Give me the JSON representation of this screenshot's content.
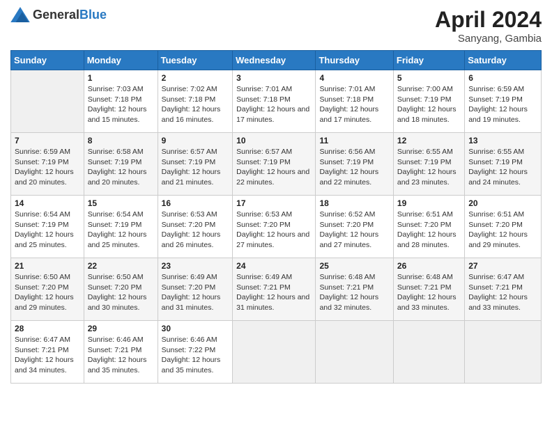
{
  "header": {
    "logo_general": "General",
    "logo_blue": "Blue",
    "month_year": "April 2024",
    "location": "Sanyang, Gambia"
  },
  "days_of_week": [
    "Sunday",
    "Monday",
    "Tuesday",
    "Wednesday",
    "Thursday",
    "Friday",
    "Saturday"
  ],
  "weeks": [
    [
      {
        "day": "",
        "sunrise": "",
        "sunset": "",
        "daylight": ""
      },
      {
        "day": "1",
        "sunrise": "Sunrise: 7:03 AM",
        "sunset": "Sunset: 7:18 PM",
        "daylight": "Daylight: 12 hours and 15 minutes."
      },
      {
        "day": "2",
        "sunrise": "Sunrise: 7:02 AM",
        "sunset": "Sunset: 7:18 PM",
        "daylight": "Daylight: 12 hours and 16 minutes."
      },
      {
        "day": "3",
        "sunrise": "Sunrise: 7:01 AM",
        "sunset": "Sunset: 7:18 PM",
        "daylight": "Daylight: 12 hours and 17 minutes."
      },
      {
        "day": "4",
        "sunrise": "Sunrise: 7:01 AM",
        "sunset": "Sunset: 7:18 PM",
        "daylight": "Daylight: 12 hours and 17 minutes."
      },
      {
        "day": "5",
        "sunrise": "Sunrise: 7:00 AM",
        "sunset": "Sunset: 7:19 PM",
        "daylight": "Daylight: 12 hours and 18 minutes."
      },
      {
        "day": "6",
        "sunrise": "Sunrise: 6:59 AM",
        "sunset": "Sunset: 7:19 PM",
        "daylight": "Daylight: 12 hours and 19 minutes."
      }
    ],
    [
      {
        "day": "7",
        "sunrise": "Sunrise: 6:59 AM",
        "sunset": "Sunset: 7:19 PM",
        "daylight": "Daylight: 12 hours and 20 minutes."
      },
      {
        "day": "8",
        "sunrise": "Sunrise: 6:58 AM",
        "sunset": "Sunset: 7:19 PM",
        "daylight": "Daylight: 12 hours and 20 minutes."
      },
      {
        "day": "9",
        "sunrise": "Sunrise: 6:57 AM",
        "sunset": "Sunset: 7:19 PM",
        "daylight": "Daylight: 12 hours and 21 minutes."
      },
      {
        "day": "10",
        "sunrise": "Sunrise: 6:57 AM",
        "sunset": "Sunset: 7:19 PM",
        "daylight": "Daylight: 12 hours and 22 minutes."
      },
      {
        "day": "11",
        "sunrise": "Sunrise: 6:56 AM",
        "sunset": "Sunset: 7:19 PM",
        "daylight": "Daylight: 12 hours and 22 minutes."
      },
      {
        "day": "12",
        "sunrise": "Sunrise: 6:55 AM",
        "sunset": "Sunset: 7:19 PM",
        "daylight": "Daylight: 12 hours and 23 minutes."
      },
      {
        "day": "13",
        "sunrise": "Sunrise: 6:55 AM",
        "sunset": "Sunset: 7:19 PM",
        "daylight": "Daylight: 12 hours and 24 minutes."
      }
    ],
    [
      {
        "day": "14",
        "sunrise": "Sunrise: 6:54 AM",
        "sunset": "Sunset: 7:19 PM",
        "daylight": "Daylight: 12 hours and 25 minutes."
      },
      {
        "day": "15",
        "sunrise": "Sunrise: 6:54 AM",
        "sunset": "Sunset: 7:19 PM",
        "daylight": "Daylight: 12 hours and 25 minutes."
      },
      {
        "day": "16",
        "sunrise": "Sunrise: 6:53 AM",
        "sunset": "Sunset: 7:20 PM",
        "daylight": "Daylight: 12 hours and 26 minutes."
      },
      {
        "day": "17",
        "sunrise": "Sunrise: 6:53 AM",
        "sunset": "Sunset: 7:20 PM",
        "daylight": "Daylight: 12 hours and 27 minutes."
      },
      {
        "day": "18",
        "sunrise": "Sunrise: 6:52 AM",
        "sunset": "Sunset: 7:20 PM",
        "daylight": "Daylight: 12 hours and 27 minutes."
      },
      {
        "day": "19",
        "sunrise": "Sunrise: 6:51 AM",
        "sunset": "Sunset: 7:20 PM",
        "daylight": "Daylight: 12 hours and 28 minutes."
      },
      {
        "day": "20",
        "sunrise": "Sunrise: 6:51 AM",
        "sunset": "Sunset: 7:20 PM",
        "daylight": "Daylight: 12 hours and 29 minutes."
      }
    ],
    [
      {
        "day": "21",
        "sunrise": "Sunrise: 6:50 AM",
        "sunset": "Sunset: 7:20 PM",
        "daylight": "Daylight: 12 hours and 29 minutes."
      },
      {
        "day": "22",
        "sunrise": "Sunrise: 6:50 AM",
        "sunset": "Sunset: 7:20 PM",
        "daylight": "Daylight: 12 hours and 30 minutes."
      },
      {
        "day": "23",
        "sunrise": "Sunrise: 6:49 AM",
        "sunset": "Sunset: 7:20 PM",
        "daylight": "Daylight: 12 hours and 31 minutes."
      },
      {
        "day": "24",
        "sunrise": "Sunrise: 6:49 AM",
        "sunset": "Sunset: 7:21 PM",
        "daylight": "Daylight: 12 hours and 31 minutes."
      },
      {
        "day": "25",
        "sunrise": "Sunrise: 6:48 AM",
        "sunset": "Sunset: 7:21 PM",
        "daylight": "Daylight: 12 hours and 32 minutes."
      },
      {
        "day": "26",
        "sunrise": "Sunrise: 6:48 AM",
        "sunset": "Sunset: 7:21 PM",
        "daylight": "Daylight: 12 hours and 33 minutes."
      },
      {
        "day": "27",
        "sunrise": "Sunrise: 6:47 AM",
        "sunset": "Sunset: 7:21 PM",
        "daylight": "Daylight: 12 hours and 33 minutes."
      }
    ],
    [
      {
        "day": "28",
        "sunrise": "Sunrise: 6:47 AM",
        "sunset": "Sunset: 7:21 PM",
        "daylight": "Daylight: 12 hours and 34 minutes."
      },
      {
        "day": "29",
        "sunrise": "Sunrise: 6:46 AM",
        "sunset": "Sunset: 7:21 PM",
        "daylight": "Daylight: 12 hours and 35 minutes."
      },
      {
        "day": "30",
        "sunrise": "Sunrise: 6:46 AM",
        "sunset": "Sunset: 7:22 PM",
        "daylight": "Daylight: 12 hours and 35 minutes."
      },
      {
        "day": "",
        "sunrise": "",
        "sunset": "",
        "daylight": ""
      },
      {
        "day": "",
        "sunrise": "",
        "sunset": "",
        "daylight": ""
      },
      {
        "day": "",
        "sunrise": "",
        "sunset": "",
        "daylight": ""
      },
      {
        "day": "",
        "sunrise": "",
        "sunset": "",
        "daylight": ""
      }
    ]
  ]
}
